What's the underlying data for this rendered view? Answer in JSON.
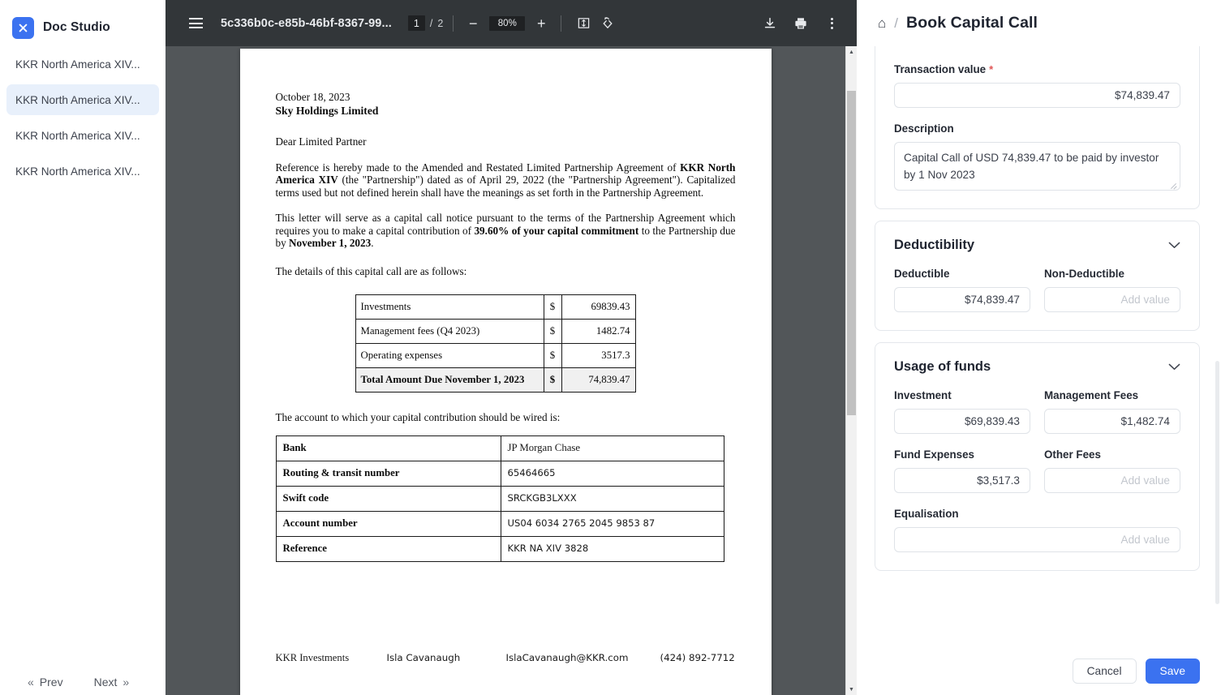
{
  "sidebar": {
    "brand": {
      "logo_icon": "close-x-icon",
      "title": "Doc Studio"
    },
    "documents": [
      {
        "label": "KKR North America XIV...",
        "active": false
      },
      {
        "label": "KKR North America XIV...",
        "active": true
      },
      {
        "label": "KKR North America XIV...",
        "active": false
      },
      {
        "label": "KKR North America XIV...",
        "active": false
      }
    ],
    "pager": {
      "prev_label": "Prev",
      "next_label": "Next",
      "prev_icon": "double-chevron-left-icon",
      "next_icon": "double-chevron-right-icon"
    }
  },
  "pdf_toolbar": {
    "menu_icon": "hamburger-menu-icon",
    "document_name": "5c336b0c-e85b-46bf-8367-99...",
    "current_page": "1",
    "page_separator": "/",
    "total_pages": "2",
    "zoom_out_icon": "minus-icon",
    "zoom_level": "80%",
    "zoom_in_icon": "plus-icon",
    "fit_page_icon": "fit-page-icon",
    "rotate_icon": "rotate-counterclockwise-icon",
    "download_icon": "download-icon",
    "print_icon": "print-icon",
    "more_icon": "kebab-menu-icon"
  },
  "document": {
    "date": "October 18, 2023",
    "company": "Sky Holdings Limited",
    "salutation": "Dear Limited Partner",
    "paragraph_1_pre": "Reference is hereby made to the Amended and Restated Limited Partnership Agreement of ",
    "paragraph_1_bold": "KKR North America XIV",
    "paragraph_1_post": " (the \"Partnership\") dated as of April 29, 2022 (the \"Partnership Agreement\"). Capitalized terms used but not defined herein shall have the meanings as set forth in the Partnership Agreement.",
    "paragraph_2_pre": "This letter will serve as a capital call notice pursuant to the terms of the Partnership Agreement which requires you to make a capital contribution of ",
    "paragraph_2_bold": "39.60% of your capital commitment",
    "paragraph_2_mid": " to the Partnership due by ",
    "paragraph_2_bold2": "November 1, 2023",
    "paragraph_2_post": ".",
    "details_lead": "The details of this capital call are as follows:",
    "amount_rows": [
      {
        "label": "Investments",
        "currency": "$",
        "value": "69839.43"
      },
      {
        "label": "Management fees (Q4 2023)",
        "currency": "$",
        "value": "1482.74"
      },
      {
        "label": "Operating expenses",
        "currency": "$",
        "value": "3517.3"
      },
      {
        "label": "Total Amount Due November 1, 2023",
        "currency": "$",
        "value": "74,839.47"
      }
    ],
    "wire_lead": "The account to which your capital contribution should be wired is:",
    "bank_rows": [
      {
        "key": "Bank",
        "value": "JP Morgan Chase"
      },
      {
        "key": "Routing & transit number",
        "value": "65464665"
      },
      {
        "key": "Swift code",
        "value": "SRCKGB3LXXX"
      },
      {
        "key": "Account number",
        "value": "US04 6034 2765 2045 9853 87"
      },
      {
        "key": "Reference",
        "value": "KKR NA XIV 3828"
      }
    ],
    "footer": {
      "org": "KKR Investments",
      "contact": "Isla Cavanaugh",
      "email": "IslaCavanaugh@KKR.com",
      "phone": "(424) 892-7712"
    }
  },
  "panel": {
    "home_icon": "home-icon",
    "breadcrumb_separator": "/",
    "title": "Book Capital Call",
    "transaction": {
      "value_label": "Transaction value",
      "required_mark": "*",
      "value": "$74,839.47",
      "description_label": "Description",
      "description": "Capital Call of USD 74,839.47 to be paid by investor by 1 Nov 2023"
    },
    "deductibility": {
      "title": "Deductibility",
      "caret_icon": "chevron-down-icon",
      "fields": [
        {
          "label": "Deductible",
          "value": "$74,839.47",
          "placeholder": "Add value"
        },
        {
          "label": "Non-Deductible",
          "value": "",
          "placeholder": "Add value"
        }
      ]
    },
    "usage_of_funds": {
      "title": "Usage of funds",
      "caret_icon": "chevron-down-icon",
      "row1": [
        {
          "label": "Investment",
          "value": "$69,839.43",
          "placeholder": "Add value"
        },
        {
          "label": "Management Fees",
          "value": "$1,482.74",
          "placeholder": "Add value"
        }
      ],
      "row2": [
        {
          "label": "Fund Expenses",
          "value": "$3,517.3",
          "placeholder": "Add value"
        },
        {
          "label": "Other Fees",
          "value": "",
          "placeholder": "Add value"
        }
      ],
      "equalisation": {
        "label": "Equalisation",
        "value": "",
        "placeholder": "Add value"
      }
    },
    "footer": {
      "cancel_label": "Cancel",
      "save_label": "Save"
    }
  },
  "colors": {
    "accent": "#3b72f0",
    "toolbar_bg": "#323639",
    "viewer_bg": "#525659",
    "sidebar_active": "#e8f0fb",
    "required": "#e05656"
  }
}
